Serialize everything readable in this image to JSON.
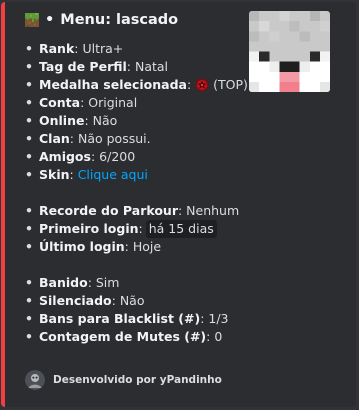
{
  "embed": {
    "accent_color": "#f23f42",
    "title_icon": "grass-block-icon",
    "title": "Menu: lascado",
    "thumbnail": "player-head-icon"
  },
  "fields": [
    {
      "label": "Rank",
      "value": "Ultra+"
    },
    {
      "label": "Tag de Perfil",
      "value": "Natal"
    },
    {
      "label": "Medalha selecionada",
      "value": "(TOP)",
      "icon": "red-medal-icon"
    },
    {
      "label": "Conta",
      "value": "Original"
    },
    {
      "label": "Online",
      "value": "Não"
    },
    {
      "label": "Clan",
      "value": "Não possui."
    },
    {
      "label": "Amigos",
      "value": "6/200"
    },
    {
      "label": "Skin",
      "value": "Clique aqui"
    },
    {
      "label": "Recorde do Parkour",
      "value": "Nenhum"
    },
    {
      "label": "Primeiro login",
      "value": "há 15 dias"
    },
    {
      "label": "Último login",
      "value": "Hoje"
    },
    {
      "label": "Banido",
      "value": "Sim"
    },
    {
      "label": "Silenciado",
      "value": "Não"
    },
    {
      "label": "Bans para Blacklist (#)",
      "value": "1/3"
    },
    {
      "label": "Contagem de Mutes (#)",
      "value": "0"
    }
  ],
  "footer": {
    "text": "Desenvolvido por yPandinho",
    "icon": "developer-avatar-icon"
  }
}
